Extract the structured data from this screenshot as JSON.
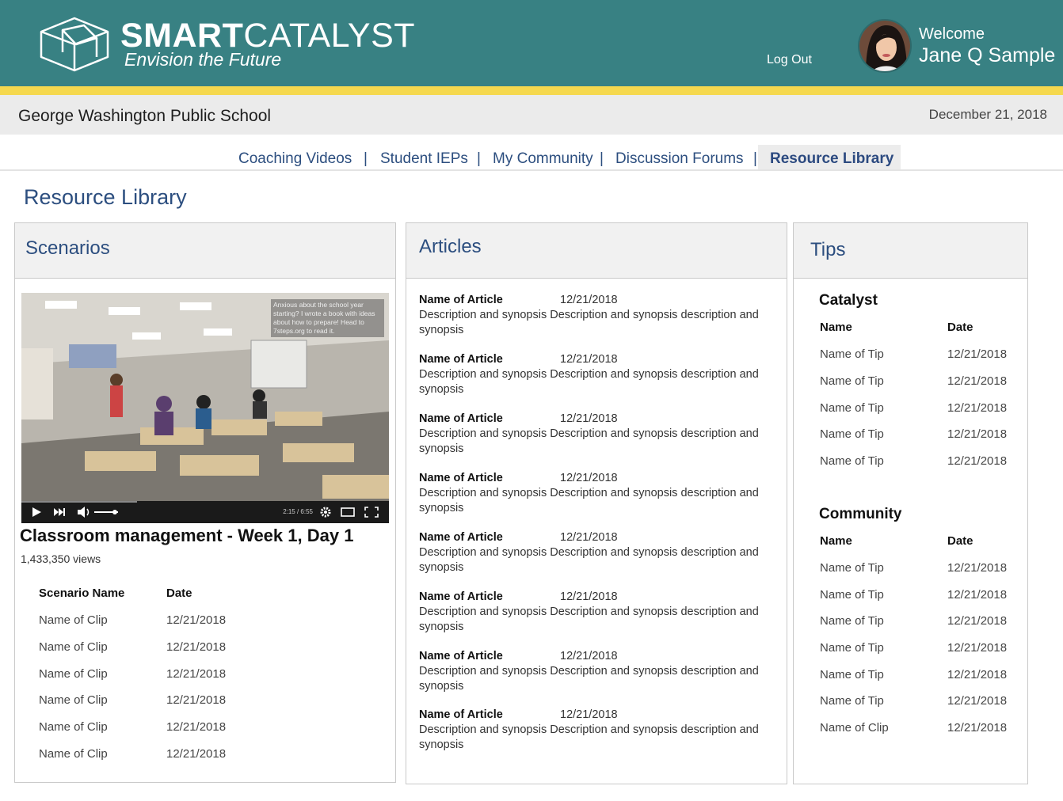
{
  "header": {
    "brand_bold": "SMART",
    "brand_light": "CATALYST",
    "tagline": "Envision the Future",
    "logout": "Log Out",
    "welcome": "Welcome",
    "username": "Jane Q Sample"
  },
  "school": {
    "name": "George Washington Public School",
    "date": "December 21, 2018"
  },
  "nav": {
    "items": [
      "Coaching Videos",
      "Student IEPs",
      "My Community",
      "Discussion Forums",
      "Resource Library"
    ],
    "separator": "|",
    "active": "Resource Library"
  },
  "page_title": "Resource Library",
  "scenarios": {
    "title": "Scenarios",
    "video": {
      "overlay": "Anxious about the school year starting? I wrote a book with ideas about how to prepare! Head to 7steps.org to read it.",
      "time": "2:15 / 6:55",
      "title": "Classroom management - Week 1, Day 1",
      "views": "1,433,350 views"
    },
    "columns": [
      "Scenario Name",
      "Date"
    ],
    "rows": [
      [
        "Name of Clip",
        "12/21/2018"
      ],
      [
        "Name of Clip",
        "12/21/2018"
      ],
      [
        "Name of Clip",
        "12/21/2018"
      ],
      [
        "Name of Clip",
        "12/21/2018"
      ],
      [
        "Name of Clip",
        "12/21/2018"
      ],
      [
        "Name of Clip",
        "12/21/2018"
      ]
    ]
  },
  "articles": {
    "title": "Articles",
    "items": [
      {
        "name": "Name of Article",
        "date": "12/21/2018",
        "desc": "Description and synopsis Description and synopsis description and synopsis"
      },
      {
        "name": "Name of Article",
        "date": "12/21/2018",
        "desc": "Description and synopsis Description and synopsis description and synopsis"
      },
      {
        "name": "Name of Article",
        "date": "12/21/2018",
        "desc": "Description and synopsis Description and synopsis description and synopsis"
      },
      {
        "name": "Name of Article",
        "date": "12/21/2018",
        "desc": "Description and synopsis Description and synopsis description and synopsis"
      },
      {
        "name": "Name of Article",
        "date": "12/21/2018",
        "desc": "Description and synopsis Description and synopsis description and synopsis"
      },
      {
        "name": "Name of Article",
        "date": "12/21/2018",
        "desc": "Description and synopsis Description and synopsis description and synopsis"
      },
      {
        "name": "Name of Article",
        "date": "12/21/2018",
        "desc": "Description and synopsis Description and synopsis description and synopsis"
      },
      {
        "name": "Name of Article",
        "date": "12/21/2018",
        "desc": "Description and synopsis Description and synopsis description and synopsis"
      }
    ]
  },
  "tips": {
    "title": "Tips",
    "catalyst": {
      "title": "Catalyst",
      "columns": [
        "Name",
        "Date"
      ],
      "rows": [
        [
          "Name of Tip",
          "12/21/2018"
        ],
        [
          "Name of Tip",
          "12/21/2018"
        ],
        [
          "Name of Tip",
          "12/21/2018"
        ],
        [
          "Name of Tip",
          "12/21/2018"
        ],
        [
          "Name of Tip",
          "12/21/2018"
        ]
      ]
    },
    "community": {
      "title": "Community",
      "columns": [
        "Name",
        "Date"
      ],
      "rows": [
        [
          "Name of Tip",
          "12/21/2018"
        ],
        [
          "Name of Tip",
          "12/21/2018"
        ],
        [
          "Name of Tip",
          "12/21/2018"
        ],
        [
          "Name of Tip",
          "12/21/2018"
        ],
        [
          "Name of Tip",
          "12/21/2018"
        ],
        [
          "Name of Tip",
          "12/21/2018"
        ],
        [
          "Name of Clip",
          "12/21/2018"
        ]
      ]
    }
  },
  "colors": {
    "header": "#388183",
    "accent_bar": "#f5d84e",
    "link": "#2c4e7f"
  }
}
